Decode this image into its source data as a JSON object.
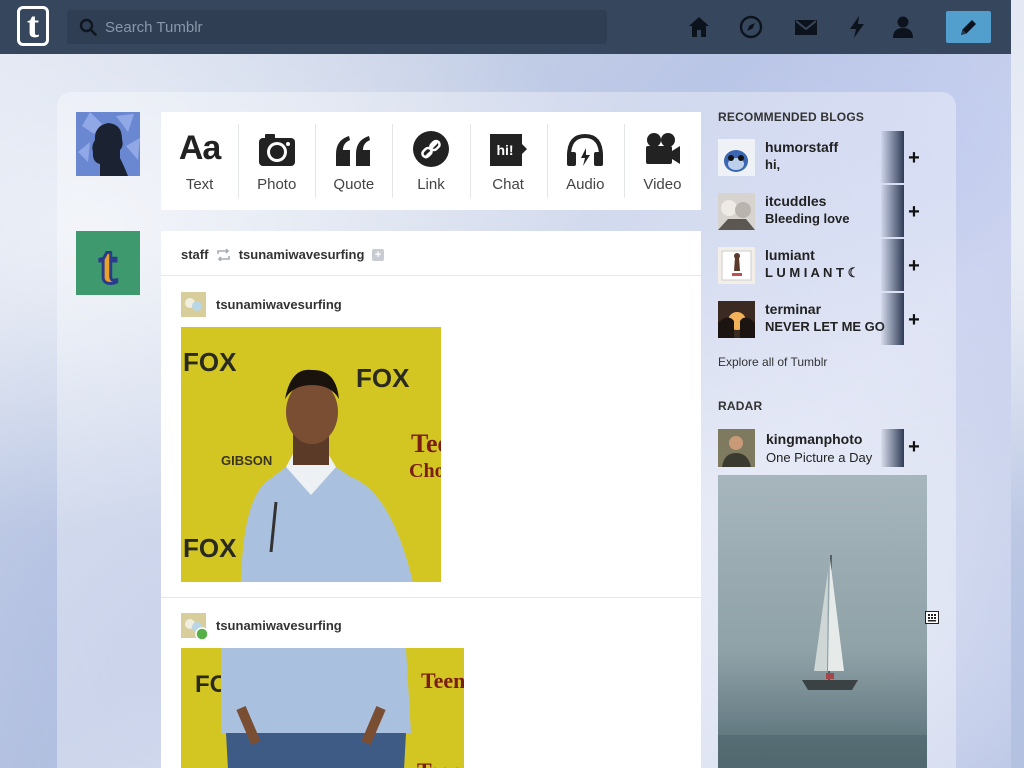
{
  "topbar": {
    "logo_letter": "t",
    "search_placeholder": "Search Tumblr",
    "nav_icons": [
      "home-icon",
      "explore-icon",
      "mail-icon",
      "activity-icon",
      "account-icon"
    ],
    "compose_icon": "pencil-icon",
    "colors": {
      "bar": "#36465d",
      "compose": "#529ecc"
    }
  },
  "post_types": [
    {
      "label": "Text",
      "icon": "Aa"
    },
    {
      "label": "Photo",
      "icon": "camera-icon"
    },
    {
      "label": "Quote",
      "icon": "quote-icon"
    },
    {
      "label": "Link",
      "icon": "link-icon"
    },
    {
      "label": "Chat",
      "icon": "hi!"
    },
    {
      "label": "Audio",
      "icon": "headphones-icon"
    },
    {
      "label": "Video",
      "icon": "video-camera-icon"
    }
  ],
  "post": {
    "reblogger": "staff",
    "source": "tsunamiwavesurfing",
    "entries": [
      {
        "name": "tsunamiwavesurfing"
      },
      {
        "name": "tsunamiwavesurfing"
      }
    ]
  },
  "recommended": {
    "title": "RECOMMENDED BLOGS",
    "blogs": [
      {
        "name": "humorstaff",
        "desc": "hi,"
      },
      {
        "name": "itcuddles",
        "desc": "Bleeding love"
      },
      {
        "name": "lumiant",
        "desc": "L U M I A N T ☾"
      },
      {
        "name": "terminar",
        "desc": "NEVER LET ME GO"
      }
    ],
    "follow_symbol": "+",
    "explore": "Explore all of Tumblr"
  },
  "radar": {
    "title": "RADAR",
    "name": "kingmanphoto",
    "desc": "One Picture a Day",
    "follow_symbol": "+"
  }
}
